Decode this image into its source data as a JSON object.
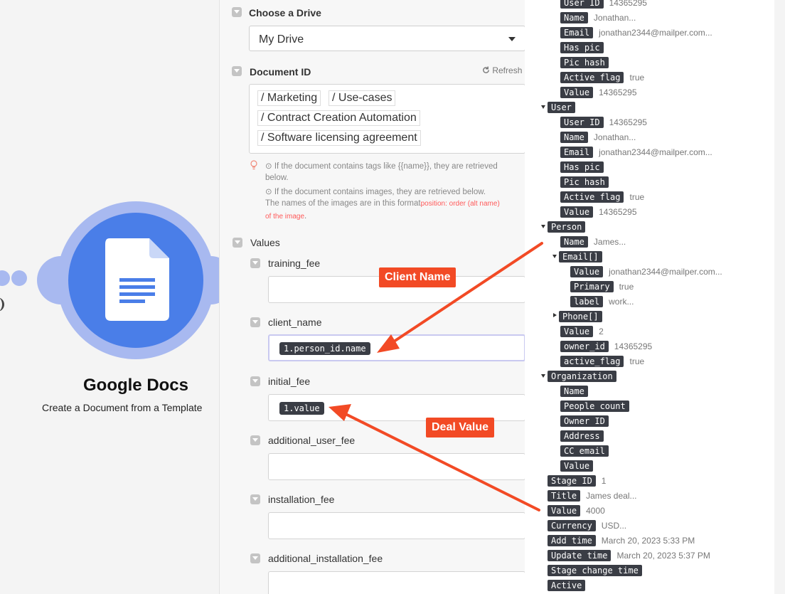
{
  "module": {
    "name": "Google Docs",
    "description": "Create a Document from a Template"
  },
  "form": {
    "drive": {
      "label": "Choose a Drive",
      "value": "My Drive"
    },
    "document": {
      "label": "Document ID",
      "refresh": "Refresh",
      "paths": [
        "Marketing",
        "Use-cases",
        "Contract Creation Automation",
        "Software licensing agreement"
      ],
      "hint1a": "If the document contains tags like {{name}}, they are retrieved",
      "hint1b": "below.",
      "hint2a": "If the document contains images, they are retrieved below.",
      "hint2b": "The names of the images are in this format",
      "hint2red": "position: order (alt name)",
      "hint3red": "of the image",
      "hint3end": "."
    },
    "values_label": "Values",
    "fields": [
      {
        "label": "training_fee",
        "token": ""
      },
      {
        "label": "client_name",
        "token": "1.person_id.name"
      },
      {
        "label": "initial_fee",
        "token": "1.value"
      },
      {
        "label": "additional_user_fee",
        "token": ""
      },
      {
        "label": "installation_fee",
        "token": ""
      },
      {
        "label": "additional_installation_fee",
        "token": ""
      }
    ]
  },
  "data_tree": [
    {
      "key": "User ID",
      "value": "14365295"
    },
    {
      "key": "Name",
      "value": "Jonathan..."
    },
    {
      "key": "Email",
      "value": "jonathan2344@mailper.com..."
    },
    {
      "key": "Has pic",
      "value": ""
    },
    {
      "key": "Pic hash",
      "value": ""
    },
    {
      "key": "Active flag",
      "value": "true"
    },
    {
      "key": "Value",
      "value": "14365295"
    },
    {
      "key": "User",
      "value": ""
    },
    {
      "key": "User ID",
      "value": "14365295"
    },
    {
      "key": "Name",
      "value": "Jonathan..."
    },
    {
      "key": "Email",
      "value": "jonathan2344@mailper.com..."
    },
    {
      "key": "Has pic",
      "value": ""
    },
    {
      "key": "Pic hash",
      "value": ""
    },
    {
      "key": "Active flag",
      "value": "true"
    },
    {
      "key": "Value",
      "value": "14365295"
    },
    {
      "key": "Person",
      "value": ""
    },
    {
      "key": "Name",
      "value": "James..."
    },
    {
      "key": "Email[]",
      "value": ""
    },
    {
      "key": "Value",
      "value": "jonathan2344@mailper.com..."
    },
    {
      "key": "Primary",
      "value": "true"
    },
    {
      "key": "label",
      "value": "work..."
    },
    {
      "key": "Phone[]",
      "value": ""
    },
    {
      "key": "Value",
      "value": "2"
    },
    {
      "key": "owner_id",
      "value": "14365295"
    },
    {
      "key": "active_flag",
      "value": "true"
    },
    {
      "key": "Organization",
      "value": ""
    },
    {
      "key": "Name",
      "value": ""
    },
    {
      "key": "People count",
      "value": ""
    },
    {
      "key": "Owner ID",
      "value": ""
    },
    {
      "key": "Address",
      "value": ""
    },
    {
      "key": "CC email",
      "value": ""
    },
    {
      "key": "Value",
      "value": ""
    },
    {
      "key": "Stage ID",
      "value": "1"
    },
    {
      "key": "Title",
      "value": "James deal..."
    },
    {
      "key": "Value",
      "value": "4000"
    },
    {
      "key": "Currency",
      "value": "USD..."
    },
    {
      "key": "Add time",
      "value": "March 20, 2023 5:33 PM"
    },
    {
      "key": "Update time",
      "value": "March 20, 2023 5:37 PM"
    },
    {
      "key": "Stage change time",
      "value": ""
    },
    {
      "key": "Active",
      "value": ""
    }
  ],
  "callouts": {
    "client_name": "Client Name",
    "deal_value": "Deal Value"
  },
  "colors": {
    "accent": "#f24a25",
    "module_blue": "#4a7ee8",
    "module_ring": "#a8b9f0",
    "token_bg": "#3a3d45"
  }
}
